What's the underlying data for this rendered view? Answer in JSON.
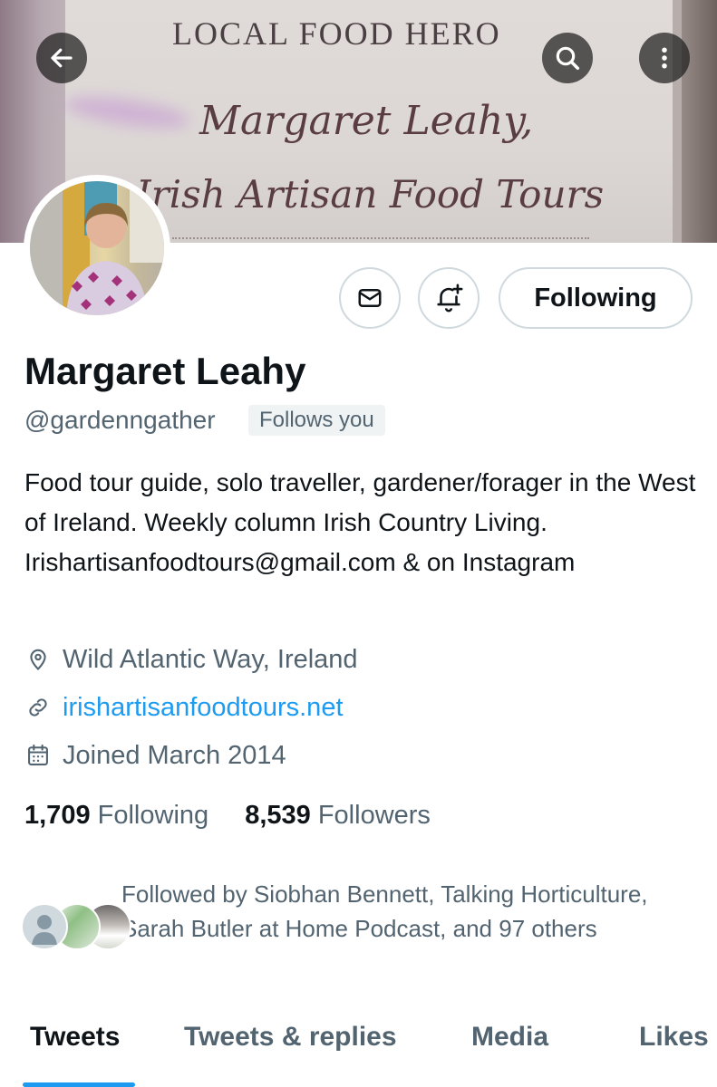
{
  "banner": {
    "line1": "LOCAL FOOD HERO",
    "line2": "Margaret Leahy,",
    "line3": "Irish Artisan Food Tours"
  },
  "top_bar": {
    "back_icon": "arrow-left-icon",
    "search_icon": "search-icon",
    "more_icon": "more-vertical-icon"
  },
  "actions": {
    "message_icon": "envelope-icon",
    "notifications_icon": "bell-plus-icon",
    "following_label": "Following"
  },
  "profile": {
    "name": "Margaret Leahy",
    "handle": "@gardenngather",
    "follows_you": "Follows you",
    "bio": "Food tour guide, solo traveller, gardener/forager in the West of Ireland.  Weekly column Irish Country Living.  Irishartisanfoodtours@gmail.com & on Instagram",
    "location": "Wild Atlantic Way, Ireland",
    "website": "irishartisanfoodtours.net",
    "joined": "Joined March 2014"
  },
  "stats": {
    "following_count": "1,709",
    "following_label": "Following",
    "followers_count": "8,539",
    "followers_label": "Followers"
  },
  "followed_by": {
    "text": "Followed by Siobhan Bennett, Talking Horticulture, Sarah Butler at Home Podcast, and 97 others"
  },
  "tabs": [
    {
      "label": "Tweets",
      "active": true
    },
    {
      "label": "Tweets & replies",
      "active": false
    },
    {
      "label": "Media",
      "active": false
    },
    {
      "label": "Likes",
      "active": false
    }
  ],
  "colors": {
    "accent": "#1d9bf0",
    "text_primary": "#0f1419",
    "text_secondary": "#536471",
    "border": "#cfd9de"
  }
}
